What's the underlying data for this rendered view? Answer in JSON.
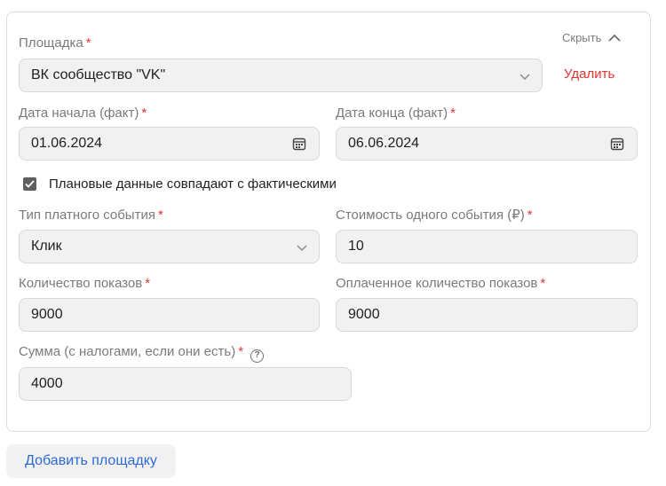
{
  "platform": {
    "label": "Площадка",
    "value": "ВК сообщество \"VK\"",
    "hide_label": "Скрыть",
    "delete_label": "Удалить"
  },
  "start_date": {
    "label": "Дата начала (факт)",
    "value": "01.06.2024"
  },
  "end_date": {
    "label": "Дата конца (факт)",
    "value": "06.06.2024"
  },
  "plan_matches": {
    "label": "Плановые данные совпадают с фактическими",
    "checked": true
  },
  "event_type": {
    "label": "Тип платного события",
    "value": "Клик"
  },
  "event_cost": {
    "label": "Стоимость одного события (₽)",
    "value": "10"
  },
  "impressions": {
    "label": "Количество показов",
    "value": "9000"
  },
  "paid_impressions": {
    "label": "Оплаченное количество показов",
    "value": "9000"
  },
  "amount": {
    "label": "Сумма (с налогами, если они есть)",
    "value": "4000"
  },
  "required_mark": "*",
  "help_mark": "?",
  "add_platform_label": "Добавить площадку"
}
